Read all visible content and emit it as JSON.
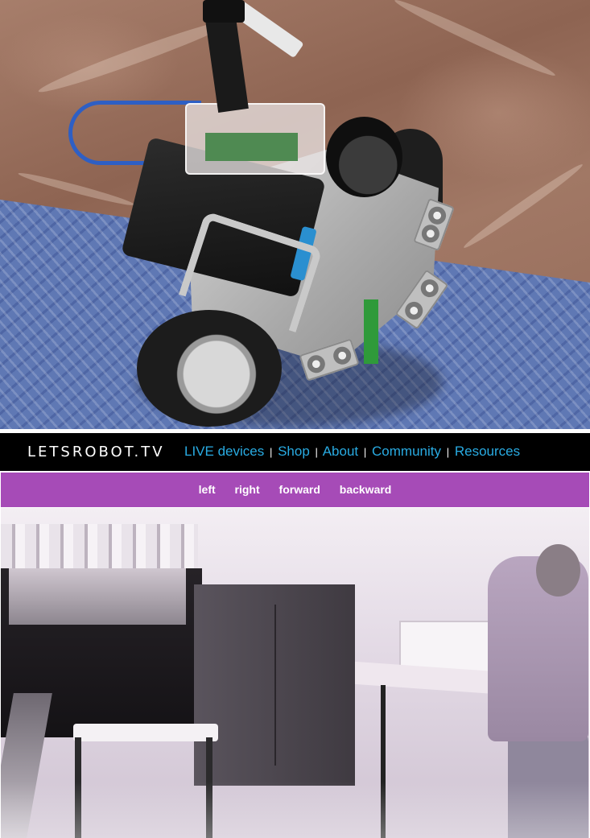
{
  "header": {
    "logo": "LETSROBOT.TV",
    "nav": [
      {
        "label": "LIVE devices"
      },
      {
        "label": "Shop"
      },
      {
        "label": "About"
      },
      {
        "label": "Community"
      },
      {
        "label": "Resources"
      }
    ],
    "separator": "|",
    "link_color": "#29abe2"
  },
  "controls": {
    "bar_color": "#a64bb7",
    "buttons": [
      {
        "label": "left"
      },
      {
        "label": "right"
      },
      {
        "label": "forward"
      },
      {
        "label": "backward"
      }
    ]
  },
  "images": {
    "robot_photo": "robot",
    "camera_feed": "office-camera-view"
  }
}
